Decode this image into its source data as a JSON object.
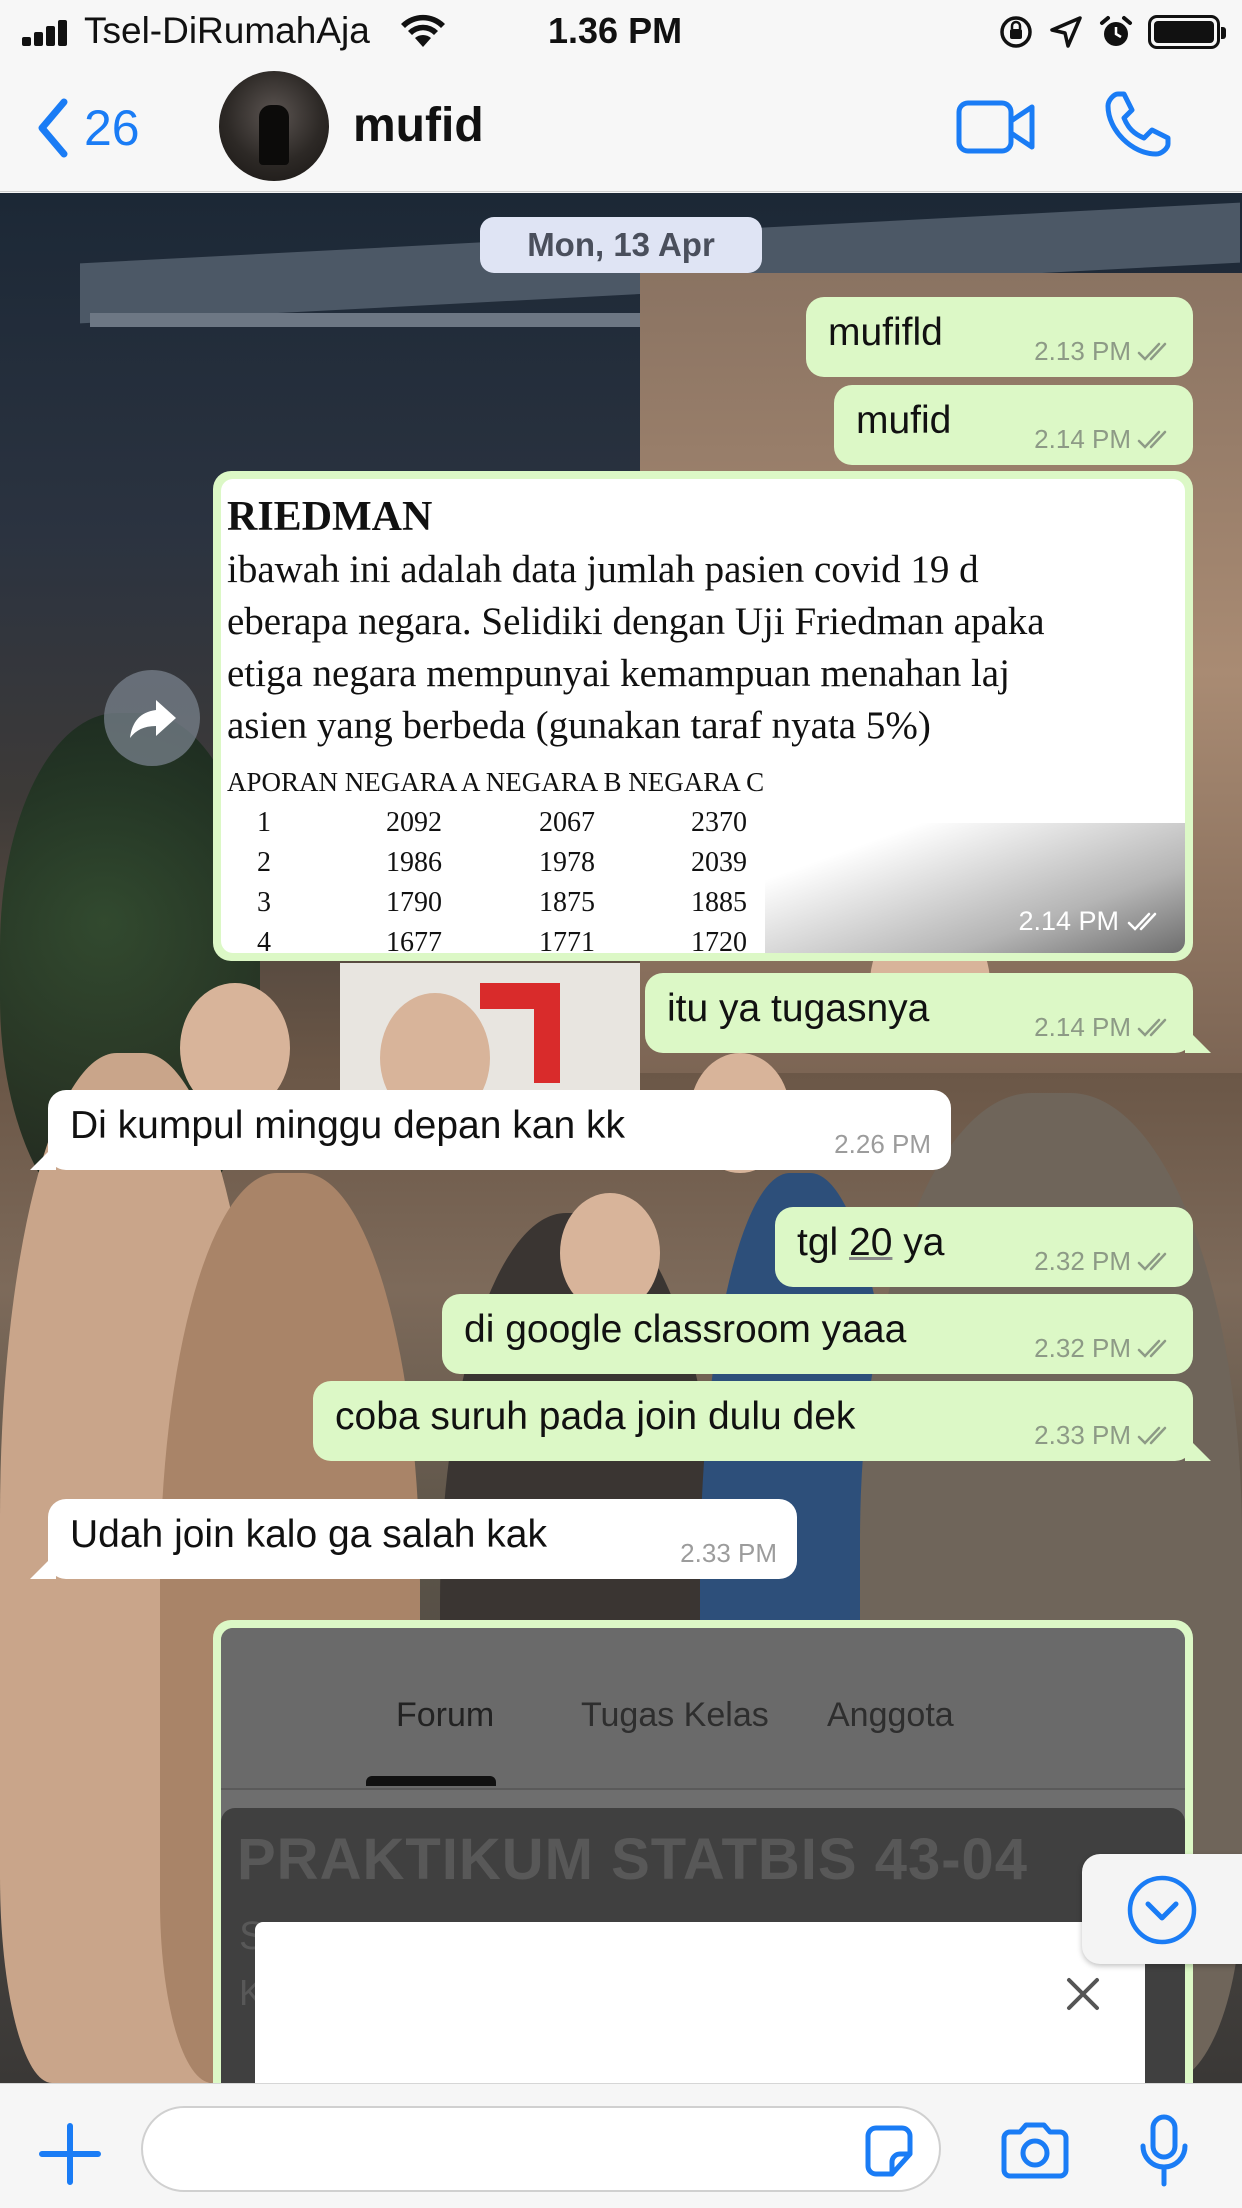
{
  "status_bar": {
    "carrier": "Tsel-DiRumahAja",
    "time": "1.36 PM"
  },
  "header": {
    "back_count": "26",
    "contact_name": "mufid"
  },
  "chat": {
    "date": "Mon, 13 Apr",
    "messages": [
      {
        "text": "mufifld",
        "time": "2.13 PM"
      },
      {
        "text": "mufid",
        "time": "2.14 PM"
      },
      {
        "text": "itu ya tugasnya",
        "time": "2.14 PM"
      },
      {
        "text": "Di kumpul minggu depan kan kk",
        "time": "2.26 PM"
      },
      {
        "text_pre": "tgl ",
        "text_link": "20",
        "text_post": " ya",
        "time": "2.32 PM"
      },
      {
        "text": "di google classroom yaaa",
        "time": "2.32 PM"
      },
      {
        "text": "coba suruh pada join dulu dek",
        "time": "2.33 PM"
      },
      {
        "text": "Udah join kalo ga salah kak",
        "time": "2.33 PM"
      }
    ],
    "image_message": {
      "time": "2.14 PM",
      "heading": "RIEDMAN",
      "lines": [
        "ibawah  ini  adalah  data  jumlah  pasien  covid  19  d",
        "eberapa negara. Selidiki dengan Uji Friedman apaka",
        "etiga  negara  mempunyai  kemampuan  menahan  laj",
        "asien yang berbeda (gunakan taraf nyata 5%)"
      ],
      "table_header": "APORAN NEGARA A NEGARA B NEGARA C",
      "rows": [
        [
          "1",
          "2092",
          "2067",
          "2370"
        ],
        [
          "2",
          "1986",
          "1978",
          "2039"
        ],
        [
          "3",
          "1790",
          "1875",
          "1885"
        ],
        [
          "4",
          "1677",
          "1771",
          "1720"
        ]
      ]
    },
    "screenshot_message": {
      "tabs": [
        "Forum",
        "Tugas Kelas",
        "Anggota"
      ],
      "title": "PRAKTIKUM STATBIS 43-04",
      "initial_s": "S",
      "initial_k": "K"
    }
  },
  "input_bar": {
    "placeholder": ""
  },
  "colors": {
    "accent": "#1a7cf5",
    "outgoing_bubble": "#dcf8c6",
    "incoming_bubble": "#ffffff",
    "date_chip": "#dfe4f4"
  },
  "icons": {
    "back": "chevron-left-icon",
    "video": "video-camera-icon",
    "call": "phone-icon",
    "forward": "share-arrow-icon",
    "read_receipt": "double-check-icon",
    "scroll": "chevron-down-circle-icon",
    "attach": "plus-icon",
    "sticker": "sticker-icon",
    "camera": "camera-icon",
    "mic": "microphone-icon",
    "close": "close-icon"
  }
}
